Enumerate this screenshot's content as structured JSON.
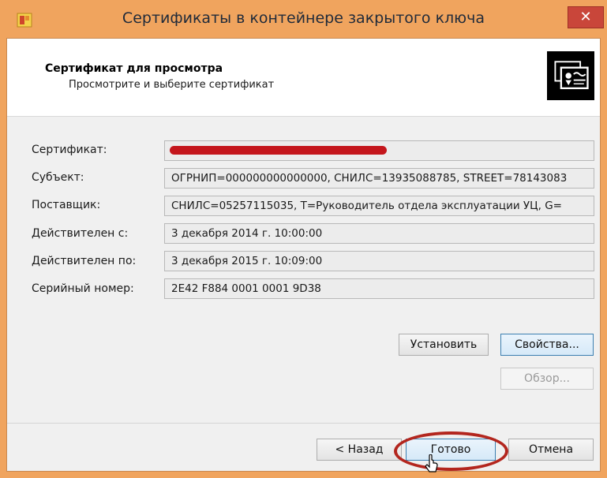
{
  "window": {
    "title": "Сертификаты в контейнере закрытого ключа",
    "close_label": "✕"
  },
  "header": {
    "title": "Сертификат для просмотра",
    "subtitle": "Просмотрите и выберите сертификат",
    "icon": "certificate-icon"
  },
  "fields": [
    {
      "label": "Сертификат:",
      "value": ""
    },
    {
      "label": "Субъект:",
      "value": "ОГРНИП=000000000000000, СНИЛС=13935088785, STREET=78143083"
    },
    {
      "label": "Поставщик:",
      "value": "СНИЛС=05257115035, T=Руководитель отдела эксплуатации УЦ, G="
    },
    {
      "label": "Действителен с:",
      "value": "3 декабря 2014 г. 10:00:00"
    },
    {
      "label": "Действителен по:",
      "value": "3 декабря 2015 г. 10:09:00"
    },
    {
      "label": "Серийный номер:",
      "value": "2E42 F884 0001 0001 9D38"
    }
  ],
  "buttons": {
    "install": "Установить",
    "properties": "Свойства...",
    "browse": "Обзор...",
    "back": "< Назад",
    "finish": "Готово",
    "cancel": "Отмена"
  },
  "colors": {
    "frame": "#f0a45e",
    "close": "#c9463a",
    "highlight": "#b3261e",
    "redaction": "#c4161c"
  }
}
